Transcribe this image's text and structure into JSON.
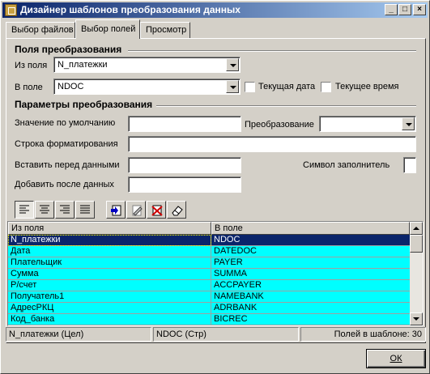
{
  "window": {
    "title": "Дизайнер шаблонов преобразования данных"
  },
  "title_buttons": {
    "minimize": "_",
    "maximize": "□",
    "close": "×"
  },
  "tabs": [
    {
      "label": "Выбор файлов"
    },
    {
      "label": "Выбор полей"
    },
    {
      "label": "Просмотр"
    }
  ],
  "conversion_fields": {
    "title": "Поля преобразования",
    "from_label": "Из поля",
    "from_value": "N_платежки",
    "to_label": "В поле",
    "to_value": "NDOC",
    "current_date_label": "Текущая дата",
    "current_time_label": "Текущее время"
  },
  "conversion_params": {
    "title": "Параметры преобразования",
    "default_value_label": "Значение по умолчанию",
    "default_value": "",
    "conversion_label": "Преобразование",
    "conversion_value": "",
    "format_string_label": "Строка форматирования",
    "format_string_value": "",
    "insert_before_label": "Вставить перед данными",
    "insert_before_value": "",
    "fill_char_label": "Символ заполнитель",
    "fill_char_value": "",
    "append_after_label": "Добавить после данных",
    "append_after_value": ""
  },
  "toolbar_icons": [
    "align-left-icon",
    "align-center-icon",
    "align-right-icon",
    "align-justify-icon",
    "add-field-icon",
    "edit-field-icon",
    "delete-field-icon",
    "eraser-icon"
  ],
  "grid": {
    "columns": [
      "Из поля",
      "В поле"
    ],
    "rows": [
      {
        "from": "N_платежки",
        "to": "NDOC"
      },
      {
        "from": "Дата",
        "to": "DATEDOC"
      },
      {
        "from": "Плательщик",
        "to": "PAYER"
      },
      {
        "from": "Сумма",
        "to": "SUMMA"
      },
      {
        "from": "Р/счет",
        "to": "ACCPAYER"
      },
      {
        "from": "Получатель1",
        "to": "NAMEBANK"
      },
      {
        "from": "АдресРКЦ",
        "to": "ADRBANK"
      },
      {
        "from": "Код_банка",
        "to": "BICREC"
      }
    ],
    "selected_row": 0
  },
  "status": {
    "source_field": "N_платежки (Цел)",
    "target_field": "NDOC (Стр)",
    "fields_count": "Полей в шаблоне: 30"
  },
  "ok_button": {
    "label": "ОК"
  },
  "colors": {
    "row_bg": "#00ffff",
    "selected_bg": "#0a246a",
    "title_start": "#0a246a",
    "title_end": "#a6caf0"
  }
}
